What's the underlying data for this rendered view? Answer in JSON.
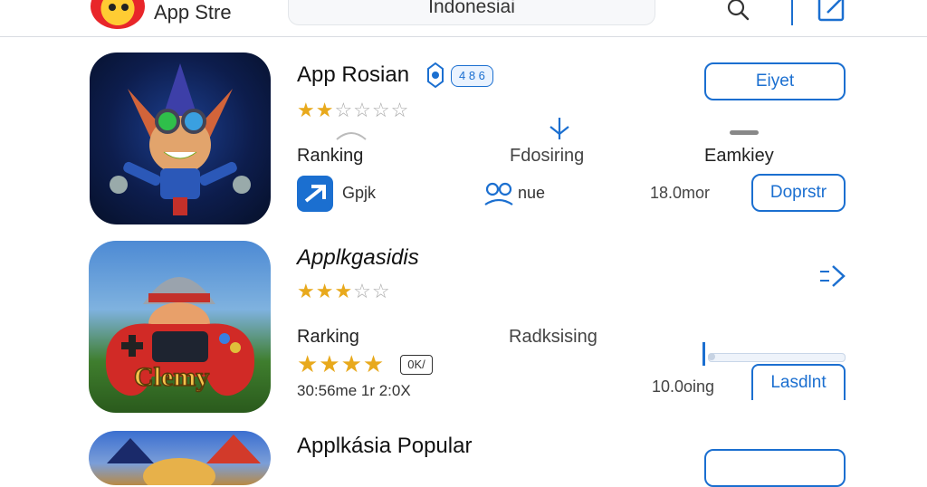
{
  "header": {
    "app_title": "App Stre",
    "search_value": "Indonesiai"
  },
  "apps": [
    {
      "name": "App Rosian",
      "badge": "4 8 6",
      "rating_stars_full": 2,
      "rating_stars_total": 6,
      "ranking_label": "Ranking",
      "middle_label": "Fdosiring",
      "right_label": "Eamkiey",
      "developer": "Gpjk",
      "category": "nue",
      "size": "18.0mor",
      "primary_button": "Eiyet",
      "secondary_button": "Doprstr"
    },
    {
      "name": "Applkgasidis",
      "rating_stars_full": 3,
      "rating_stars_total": 5,
      "ranking_label": "Rarking",
      "middle_label": "Radksising",
      "review_stars_full": 4,
      "age_badge": "0K/",
      "meta": "30:56me 1r 2:0X",
      "size": "10.0oing",
      "install_progress": 0.05,
      "install_button": "Lasdlnt"
    },
    {
      "name": "Applkásia Popular"
    }
  ],
  "colors": {
    "accent": "#1b6fd0",
    "star": "#e8a91c"
  }
}
